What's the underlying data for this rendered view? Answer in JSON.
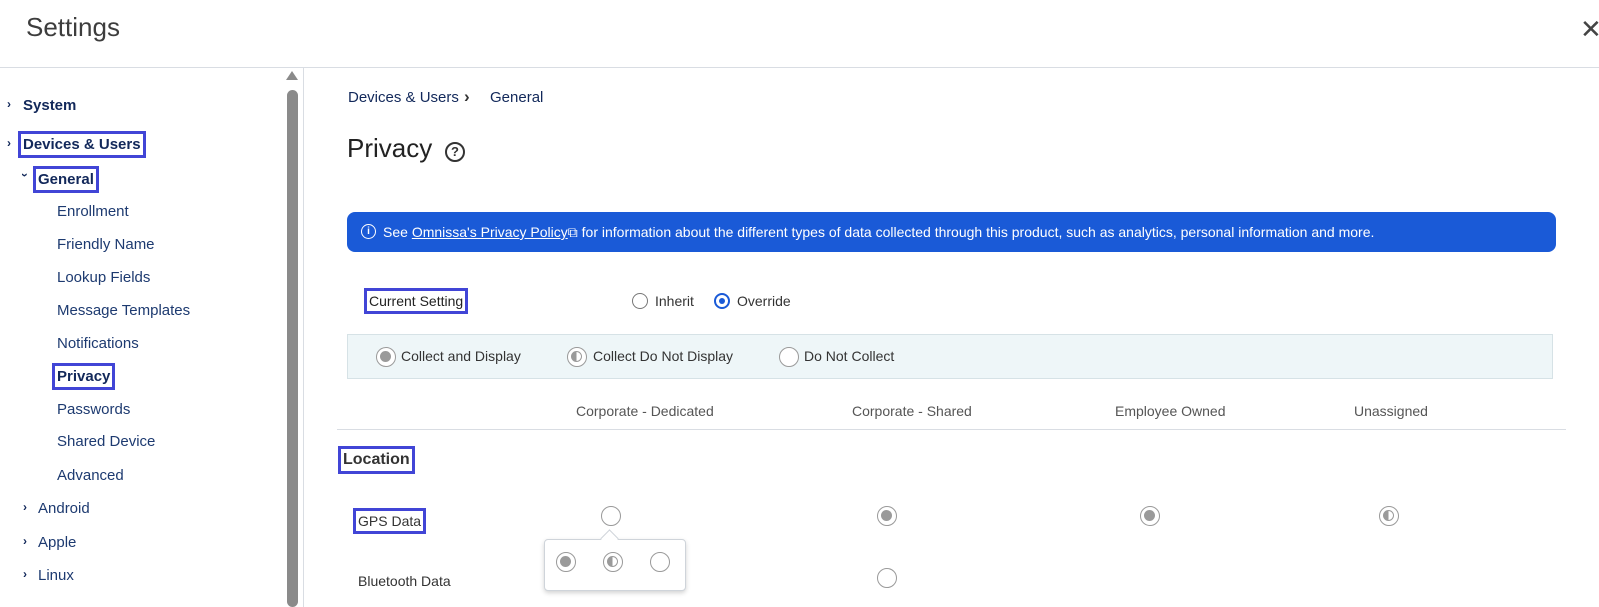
{
  "header": {
    "title": "Settings",
    "close_glyph": "✕",
    "close_icon": "close-icon"
  },
  "sidebar": {
    "system": "System",
    "devices_users": "Devices & Users",
    "general": "General",
    "general_items": [
      "Enrollment",
      "Friendly Name",
      "Lookup Fields",
      "Message Templates",
      "Notifications",
      "Privacy",
      "Passwords",
      "Shared Device",
      "Advanced"
    ],
    "android": "Android",
    "apple": "Apple",
    "linux": "Linux",
    "selected": "Privacy"
  },
  "breadcrumb": {
    "parent": "Devices & Users",
    "current": "General"
  },
  "page": {
    "title": "Privacy",
    "help_glyph": "?"
  },
  "banner": {
    "prefix": "See ",
    "link": "Omnissa's Privacy Policy",
    "suffix": " for information about the different types of data collected through this product, such as analytics, personal information and more.",
    "info_glyph": "i",
    "background": "#1a5ad7"
  },
  "current_setting": {
    "label": "Current Setting",
    "options": [
      "Inherit",
      "Override"
    ],
    "selected": "Override"
  },
  "legend": {
    "collect_display": "Collect and Display",
    "collect_no_display": "Collect Do Not Display",
    "no_collect": "Do Not Collect"
  },
  "columns": [
    "Corporate - Dedicated",
    "Corporate - Shared",
    "Employee Owned",
    "Unassigned"
  ],
  "location": {
    "title": "Location",
    "rows": [
      {
        "label": "GPS Data",
        "values": [
          "none",
          "full",
          "full",
          "half"
        ]
      },
      {
        "label": "Bluetooth Data",
        "values": [
          "",
          "none",
          "",
          ""
        ]
      }
    ]
  },
  "popover_options": [
    "full",
    "half",
    "none"
  ],
  "accent_color": "#4145d6"
}
